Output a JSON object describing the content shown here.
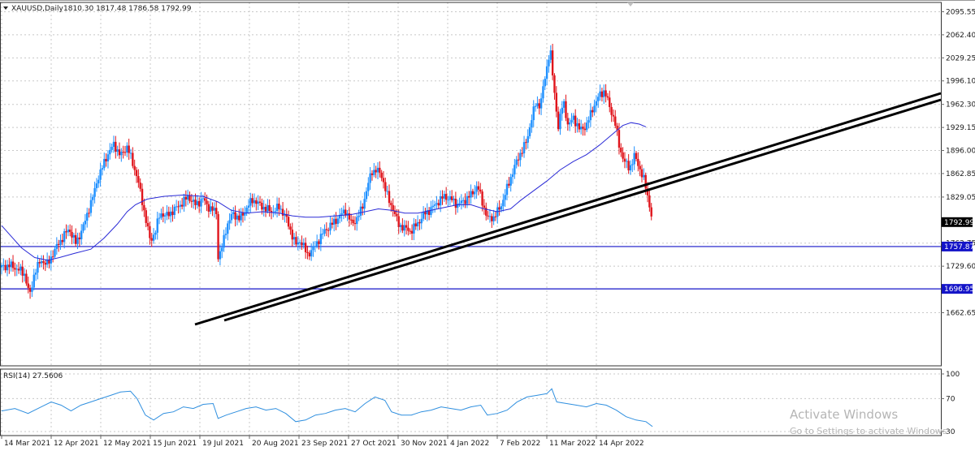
{
  "header": {
    "symbol_label": "XAUUSD,Daily",
    "ohlc_label": "1810.30 1817.48 1786.58 1792.99"
  },
  "rsi_label": "RSI(14) 27.5606",
  "watermark": {
    "title": "Activate Windows",
    "subtitle": "Go to Settings to activate Windows."
  },
  "colors": {
    "bull": "#1e90ff",
    "bear": "#e0141b",
    "ma": "#2a2ad6",
    "rsi": "#2f8fdf",
    "hline": "#1414c8",
    "trend": "#000000",
    "grid": "#c8c8c8",
    "price_tag_bg": "#000000",
    "level_tag_bg": "#1414c8"
  },
  "chart_data": {
    "type": "candlestick",
    "symbol": "XAUUSD",
    "timeframe": "Daily",
    "price_axis": {
      "ticks": [
        "2095.55",
        "2062.40",
        "2029.25",
        "1996.10",
        "1962.30",
        "1929.15",
        "1896.00",
        "1862.85",
        "1829.05",
        "1762.75",
        "1729.60",
        "1662.65"
      ],
      "range": [
        1650,
        2105
      ]
    },
    "current_price": "1792.99",
    "horizontal_levels": [
      "1757.87",
      "1696.95"
    ],
    "time_axis": [
      "14 Mar 2021",
      "12 Apr 2021",
      "12 May 2021",
      "15 Jun 2021",
      "19 Jul 2021",
      "20 Aug 2021",
      "23 Sep 2021",
      "27 Oct 2021",
      "30 Nov 2021",
      "4 Jan 2022",
      "7 Feb 2022",
      "11 Mar 2022",
      "14 Apr 2022"
    ],
    "price_path": [
      [
        0,
        1728
      ],
      [
        0.5,
        1731
      ],
      [
        1,
        1725
      ],
      [
        1.4,
        1718
      ],
      [
        1.7,
        1686
      ],
      [
        2,
        1722
      ],
      [
        2.4,
        1738
      ],
      [
        2.8,
        1732
      ],
      [
        3.1,
        1748
      ],
      [
        3.4,
        1760
      ],
      [
        3.8,
        1775
      ],
      [
        4.1,
        1783
      ],
      [
        4.5,
        1762
      ],
      [
        5,
        1790
      ],
      [
        5.3,
        1814
      ],
      [
        5.6,
        1835
      ],
      [
        5.8,
        1855
      ],
      [
        6.1,
        1872
      ],
      [
        6.4,
        1890
      ],
      [
        6.8,
        1905
      ],
      [
        7.2,
        1888
      ],
      [
        7.6,
        1902
      ],
      [
        7.9,
        1880
      ],
      [
        8.2,
        1858
      ],
      [
        8.6,
        1812
      ],
      [
        9,
        1765
      ],
      [
        9.3,
        1780
      ],
      [
        9.6,
        1806
      ],
      [
        10,
        1802
      ],
      [
        10.5,
        1812
      ],
      [
        10.9,
        1820
      ],
      [
        11.3,
        1830
      ],
      [
        11.7,
        1818
      ],
      [
        12.2,
        1826
      ],
      [
        12.6,
        1812
      ],
      [
        13,
        1808
      ],
      [
        13.1,
        1742
      ],
      [
        13.3,
        1752
      ],
      [
        13.6,
        1786
      ],
      [
        14,
        1806
      ],
      [
        14.4,
        1797
      ],
      [
        14.8,
        1812
      ],
      [
        15.2,
        1826
      ],
      [
        15.6,
        1818
      ],
      [
        16,
        1812
      ],
      [
        16.4,
        1808
      ],
      [
        16.8,
        1815
      ],
      [
        17.2,
        1800
      ],
      [
        17.5,
        1780
      ],
      [
        17.8,
        1760
      ],
      [
        18.1,
        1767
      ],
      [
        18.5,
        1746
      ],
      [
        18.9,
        1756
      ],
      [
        19.2,
        1768
      ],
      [
        19.6,
        1782
      ],
      [
        20,
        1790
      ],
      [
        20.4,
        1800
      ],
      [
        20.8,
        1810
      ],
      [
        21.2,
        1790
      ],
      [
        21.5,
        1798
      ],
      [
        21.8,
        1812
      ],
      [
        22.1,
        1840
      ],
      [
        22.4,
        1866
      ],
      [
        22.7,
        1868
      ],
      [
        23,
        1860
      ],
      [
        23.4,
        1826
      ],
      [
        23.7,
        1812
      ],
      [
        24,
        1790
      ],
      [
        24.4,
        1784
      ],
      [
        24.8,
        1780
      ],
      [
        25.2,
        1792
      ],
      [
        25.6,
        1805
      ],
      [
        26,
        1812
      ],
      [
        26.4,
        1822
      ],
      [
        26.8,
        1830
      ],
      [
        27.2,
        1826
      ],
      [
        27.6,
        1818
      ],
      [
        28,
        1824
      ],
      [
        28.4,
        1832
      ],
      [
        28.8,
        1845
      ],
      [
        29.1,
        1822
      ],
      [
        29.4,
        1798
      ],
      [
        29.8,
        1800
      ],
      [
        30.2,
        1815
      ],
      [
        30.6,
        1842
      ],
      [
        31,
        1870
      ],
      [
        31.4,
        1892
      ],
      [
        31.8,
        1910
      ],
      [
        32,
        1935
      ],
      [
        32.3,
        1962
      ],
      [
        32.6,
        1962
      ],
      [
        32.8,
        1988
      ],
      [
        33,
        2015
      ],
      [
        33.2,
        2045
      ],
      [
        33.4,
        1990
      ],
      [
        33.7,
        1930
      ],
      [
        34,
        1968
      ],
      [
        34.3,
        1930
      ],
      [
        34.6,
        1944
      ],
      [
        35,
        1925
      ],
      [
        35.4,
        1932
      ],
      [
        35.8,
        1958
      ],
      [
        36.2,
        1976
      ],
      [
        36.5,
        1982
      ],
      [
        36.8,
        1958
      ],
      [
        37.1,
        1940
      ],
      [
        37.4,
        1900
      ],
      [
        37.7,
        1880
      ],
      [
        38,
        1870
      ],
      [
        38.3,
        1888
      ],
      [
        38.6,
        1872
      ],
      [
        38.9,
        1852
      ],
      [
        39.2,
        1820
      ],
      [
        39.4,
        1792
      ]
    ],
    "ma_path": [
      [
        0,
        1788
      ],
      [
        0.6,
        1772
      ],
      [
        1.2,
        1756
      ],
      [
        2,
        1742
      ],
      [
        2.8,
        1738
      ],
      [
        3.5,
        1742
      ],
      [
        4.4,
        1748
      ],
      [
        5.4,
        1754
      ],
      [
        6.2,
        1770
      ],
      [
        7,
        1790
      ],
      [
        7.6,
        1808
      ],
      [
        8.1,
        1818
      ],
      [
        8.8,
        1826
      ],
      [
        9.8,
        1830
      ],
      [
        11,
        1832
      ],
      [
        12.2,
        1830
      ],
      [
        13.1,
        1822
      ],
      [
        13.9,
        1810
      ],
      [
        14.8,
        1806
      ],
      [
        15.8,
        1808
      ],
      [
        16.8,
        1806
      ],
      [
        17.6,
        1802
      ],
      [
        18.4,
        1800
      ],
      [
        19.2,
        1800
      ],
      [
        20.2,
        1802
      ],
      [
        21.2,
        1804
      ],
      [
        22,
        1808
      ],
      [
        22.8,
        1812
      ],
      [
        23.6,
        1810
      ],
      [
        24.4,
        1806
      ],
      [
        25.2,
        1806
      ],
      [
        26,
        1810
      ],
      [
        26.8,
        1814
      ],
      [
        27.6,
        1818
      ],
      [
        28.4,
        1818
      ],
      [
        29.2,
        1812
      ],
      [
        30,
        1808
      ],
      [
        30.8,
        1812
      ],
      [
        31.4,
        1824
      ],
      [
        32.2,
        1838
      ],
      [
        33,
        1852
      ],
      [
        33.8,
        1868
      ],
      [
        34.6,
        1880
      ],
      [
        35.4,
        1890
      ],
      [
        36.2,
        1904
      ],
      [
        37,
        1920
      ],
      [
        37.6,
        1932
      ],
      [
        38.1,
        1936
      ],
      [
        38.6,
        1934
      ],
      [
        39,
        1930
      ]
    ],
    "rsi": {
      "period": 14,
      "value": "27.5606",
      "ticks": [
        "100",
        "70",
        "30"
      ],
      "range": [
        0,
        100
      ],
      "path": [
        [
          0,
          55
        ],
        [
          0.8,
          58
        ],
        [
          1.6,
          52
        ],
        [
          2.4,
          60
        ],
        [
          3,
          66
        ],
        [
          3.6,
          62
        ],
        [
          4.2,
          55
        ],
        [
          4.8,
          62
        ],
        [
          5.4,
          66
        ],
        [
          6,
          70
        ],
        [
          6.6,
          74
        ],
        [
          7.2,
          78
        ],
        [
          7.8,
          79
        ],
        [
          8.2,
          70
        ],
        [
          8.7,
          50
        ],
        [
          9.2,
          44
        ],
        [
          9.8,
          52
        ],
        [
          10.4,
          54
        ],
        [
          11,
          60
        ],
        [
          11.6,
          58
        ],
        [
          12.2,
          63
        ],
        [
          12.8,
          64
        ],
        [
          13.1,
          46
        ],
        [
          13.6,
          50
        ],
        [
          14.2,
          54
        ],
        [
          14.8,
          58
        ],
        [
          15.4,
          60
        ],
        [
          16,
          56
        ],
        [
          16.6,
          58
        ],
        [
          17.2,
          52
        ],
        [
          17.8,
          42
        ],
        [
          18.4,
          44
        ],
        [
          19,
          50
        ],
        [
          19.6,
          52
        ],
        [
          20.2,
          56
        ],
        [
          20.8,
          58
        ],
        [
          21.4,
          54
        ],
        [
          22,
          64
        ],
        [
          22.6,
          72
        ],
        [
          23.2,
          68
        ],
        [
          23.6,
          54
        ],
        [
          24.2,
          50
        ],
        [
          24.8,
          50
        ],
        [
          25.4,
          54
        ],
        [
          26,
          56
        ],
        [
          26.6,
          60
        ],
        [
          27.2,
          58
        ],
        [
          27.8,
          56
        ],
        [
          28.4,
          60
        ],
        [
          29,
          62
        ],
        [
          29.4,
          50
        ],
        [
          30,
          52
        ],
        [
          30.6,
          56
        ],
        [
          31.2,
          66
        ],
        [
          31.8,
          72
        ],
        [
          32.4,
          74
        ],
        [
          33,
          76
        ],
        [
          33.3,
          82
        ],
        [
          33.6,
          66
        ],
        [
          34.2,
          64
        ],
        [
          34.8,
          62
        ],
        [
          35.4,
          60
        ],
        [
          36,
          64
        ],
        [
          36.6,
          62
        ],
        [
          37.2,
          56
        ],
        [
          37.8,
          48
        ],
        [
          38.4,
          44
        ],
        [
          39,
          42
        ],
        [
          39.4,
          36
        ]
      ]
    },
    "trendlines": [
      {
        "from": [
          "19 Jul 2021",
          1675
        ],
        "to": [
          "axis end",
          1990
        ]
      },
      {
        "from": [
          "1 Aug 2021",
          1682
        ],
        "to": [
          "axis end",
          1978
        ]
      }
    ]
  }
}
